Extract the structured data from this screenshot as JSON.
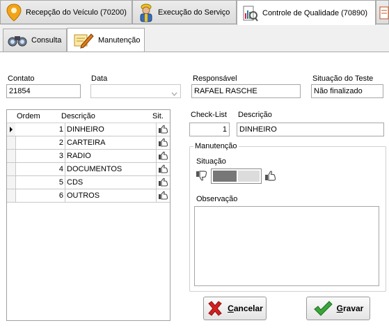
{
  "top_tabs": [
    {
      "label": "Recepção do Veículo (70200)",
      "icon": "map-pin-icon",
      "active": false
    },
    {
      "label": "Execução do Serviço",
      "icon": "mechanic-icon",
      "active": false
    },
    {
      "label": "Controle de Qualidade (70890)",
      "icon": "quality-chart-icon",
      "active": true
    },
    {
      "label": "",
      "icon": "document-icon",
      "active": false
    }
  ],
  "sub_tabs": [
    {
      "label": "Consulta",
      "icon": "binoculars-icon",
      "active": false
    },
    {
      "label": "Manutenção",
      "icon": "pencil-icon",
      "active": true
    }
  ],
  "form": {
    "contato_label": "Contato",
    "contato_value": "21854",
    "data_label": "Data",
    "data_value": "",
    "responsavel_label": "Responsável",
    "responsavel_value": "RAFAEL RASCHE",
    "situacao_teste_label": "Situação do Teste",
    "situacao_teste_value": "Não finalizado"
  },
  "grid": {
    "headers": {
      "ordem": "Ordem",
      "descricao": "Descrição",
      "sit": "Sit."
    },
    "rows": [
      {
        "ordem": "1",
        "descricao": "DINHEIRO",
        "selected": true
      },
      {
        "ordem": "2",
        "descricao": "CARTEIRA",
        "selected": false
      },
      {
        "ordem": "3",
        "descricao": "RADIO",
        "selected": false
      },
      {
        "ordem": "4",
        "descricao": "DOCUMENTOS",
        "selected": false
      },
      {
        "ordem": "5",
        "descricao": "CDS",
        "selected": false
      },
      {
        "ordem": "6",
        "descricao": "OUTROS",
        "selected": false
      }
    ]
  },
  "detail": {
    "checklist_label": "Check-List",
    "checklist_value": "1",
    "descricao_label": "Descrição",
    "descricao_value": "DINHEIRO",
    "group_title": "Manutenção",
    "situacao_label": "Situação",
    "observacao_label": "Observação",
    "observacao_value": ""
  },
  "buttons": {
    "cancelar_first": "C",
    "cancelar_rest": "ancelar",
    "gravar_first": "G",
    "gravar_rest": "ravar"
  },
  "colors": {
    "cancel_red": "#d42020",
    "save_green": "#3aa53a"
  }
}
